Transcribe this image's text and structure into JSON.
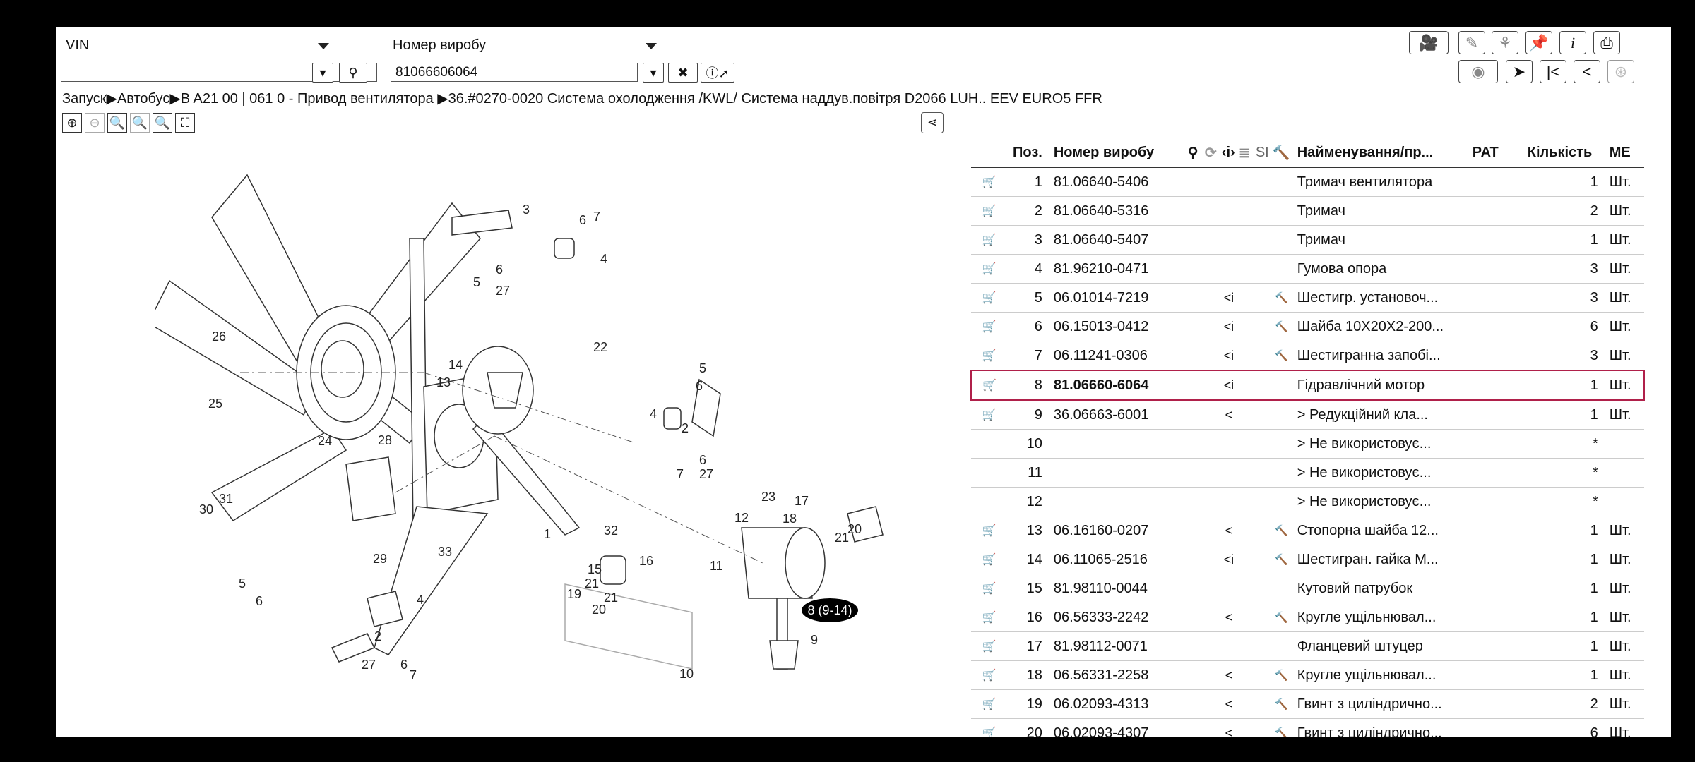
{
  "search": {
    "vin_label": "VIN",
    "vin_value": "",
    "product_label": "Номер виробу",
    "product_value": "81066606064"
  },
  "breadcrumb": "Запуск▶Автобус▶B A21 00 | 061 0 - Привод вентилятора ▶36.#0270-0020  Система охолодження /KWL/ Система наддув.повітря  D2066 LUH.. EEV  EURO5 FFR",
  "toolbar": {
    "row1": [
      "print-icon",
      "info-icon",
      "pin-icon",
      "hierarchy-icon",
      "edit-icon",
      "video-icon"
    ],
    "row2": [
      "wheel-icon",
      "arrow-icon",
      "first-icon",
      "prev-icon",
      "disabled-icon"
    ]
  },
  "table": {
    "headers": {
      "pos": "Поз.",
      "number": "Номер виробу",
      "name": "Найменування/пр...",
      "pat": "PAT",
      "qty": "Кількість",
      "me": "МЕ",
      "si": "SI"
    },
    "rows": [
      {
        "pos": "1",
        "number": "81.06640-5406",
        "flag": "",
        "tool": false,
        "name": "Тримач вентилятора",
        "qty": "1",
        "me": "Шт.",
        "cart": true
      },
      {
        "pos": "2",
        "number": "81.06640-5316",
        "flag": "",
        "tool": false,
        "name": "Тримач",
        "qty": "2",
        "me": "Шт.",
        "cart": true
      },
      {
        "pos": "3",
        "number": "81.06640-5407",
        "flag": "",
        "tool": false,
        "name": "Тримач",
        "qty": "1",
        "me": "Шт.",
        "cart": true
      },
      {
        "pos": "4",
        "number": "81.96210-0471",
        "flag": "",
        "tool": false,
        "name": "Гумова опора",
        "qty": "3",
        "me": "Шт.",
        "cart": true
      },
      {
        "pos": "5",
        "number": "06.01014-7219",
        "flag": "<i",
        "tool": true,
        "name": "Шестигр. установоч...",
        "qty": "3",
        "me": "Шт.",
        "cart": true
      },
      {
        "pos": "6",
        "number": "06.15013-0412",
        "flag": "<i",
        "tool": true,
        "name": "Шайба  10X20X2-200...",
        "qty": "6",
        "me": "Шт.",
        "cart": true
      },
      {
        "pos": "7",
        "number": "06.11241-0306",
        "flag": "<i",
        "tool": true,
        "name": "Шестигранна запобі...",
        "qty": "3",
        "me": "Шт.",
        "cart": true
      },
      {
        "pos": "8",
        "number": "81.06660-6064",
        "flag": "<i",
        "tool": false,
        "name": "Гідравлічний мотор",
        "qty": "1",
        "me": "Шт.",
        "cart": true,
        "selected": true
      },
      {
        "pos": "9",
        "number": "36.06663-6001",
        "flag": "<",
        "tool": false,
        "name": "> Редукційний кла...",
        "qty": "1",
        "me": "Шт.",
        "cart": true
      },
      {
        "pos": "10",
        "number": "",
        "flag": "",
        "tool": false,
        "name": "> Не використовує...",
        "qty": "*",
        "me": "",
        "cart": false
      },
      {
        "pos": "11",
        "number": "",
        "flag": "",
        "tool": false,
        "name": "> Не використовує...",
        "qty": "*",
        "me": "",
        "cart": false
      },
      {
        "pos": "12",
        "number": "",
        "flag": "",
        "tool": false,
        "name": "> Не використовує...",
        "qty": "*",
        "me": "",
        "cart": false
      },
      {
        "pos": "13",
        "number": "06.16160-0207",
        "flag": "<",
        "tool": true,
        "name": "Стопорна шайба  12...",
        "qty": "1",
        "me": "Шт.",
        "cart": true
      },
      {
        "pos": "14",
        "number": "06.11065-2516",
        "flag": "<i",
        "tool": true,
        "name": "Шестигран. гайка  M...",
        "qty": "1",
        "me": "Шт.",
        "cart": true
      },
      {
        "pos": "15",
        "number": "81.98110-0044",
        "flag": "",
        "tool": false,
        "name": "Кутовий патрубок",
        "qty": "1",
        "me": "Шт.",
        "cart": true
      },
      {
        "pos": "16",
        "number": "06.56333-2242",
        "flag": "<",
        "tool": true,
        "name": "Кругле ущільнювал...",
        "qty": "1",
        "me": "Шт.",
        "cart": true
      },
      {
        "pos": "17",
        "number": "81.98112-0071",
        "flag": "",
        "tool": false,
        "name": "Фланцевий штуцер",
        "qty": "1",
        "me": "Шт.",
        "cart": true
      },
      {
        "pos": "18",
        "number": "06.56331-2258",
        "flag": "<",
        "tool": true,
        "name": "Кругле ущільнювал...",
        "qty": "1",
        "me": "Шт.",
        "cart": true
      },
      {
        "pos": "19",
        "number": "06.02093-4313",
        "flag": "<",
        "tool": true,
        "name": "Гвинт з циліндрично...",
        "qty": "2",
        "me": "Шт.",
        "cart": true
      },
      {
        "pos": "20",
        "number": "06.02093-4307",
        "flag": "<",
        "tool": true,
        "name": "Гвинт з циліндрично...",
        "qty": "6",
        "me": "Шт.",
        "cart": true
      }
    ]
  },
  "drawing": {
    "callout": "8 (9-14)",
    "labels": [
      "1",
      "2",
      "3",
      "4",
      "5",
      "6",
      "7",
      "9",
      "10",
      "11",
      "12",
      "13",
      "14",
      "15",
      "16",
      "17",
      "18",
      "19",
      "20",
      "21",
      "22",
      "23",
      "24",
      "25",
      "26",
      "27",
      "28",
      "29",
      "30",
      "31",
      "32",
      "33",
      "4",
      "5",
      "6",
      "7",
      "27",
      "27",
      "6",
      "7",
      "2",
      "4",
      "5",
      "6",
      "21",
      "20"
    ]
  }
}
